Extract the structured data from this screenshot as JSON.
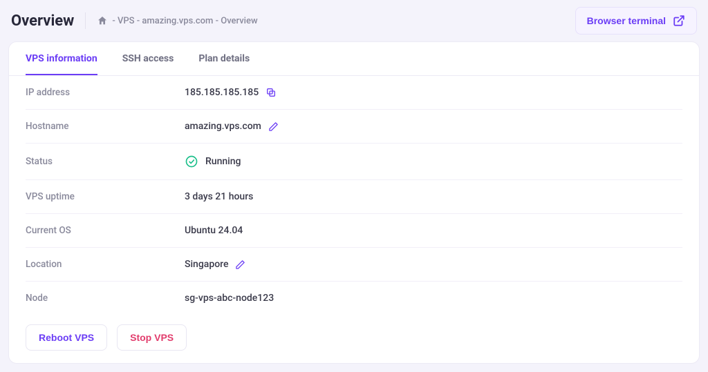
{
  "header": {
    "title": "Overview",
    "breadcrumb_text": "- VPS - amazing.vps.com - Overview",
    "terminal_button_label": "Browser terminal"
  },
  "tabs": {
    "info": "VPS information",
    "ssh": "SSH access",
    "plan": "Plan details"
  },
  "info": {
    "ip_label": "IP address",
    "ip_value": "185.185.185.185",
    "hostname_label": "Hostname",
    "hostname_value": "amazing.vps.com",
    "status_label": "Status",
    "status_value": "Running",
    "uptime_label": "VPS uptime",
    "uptime_value": "3 days 21 hours",
    "os_label": "Current OS",
    "os_value": "Ubuntu 24.04",
    "location_label": "Location",
    "location_value": "Singapore",
    "node_label": "Node",
    "node_value": "sg-vps-abc-node123"
  },
  "actions": {
    "reboot": "Reboot VPS",
    "stop": "Stop VPS"
  },
  "colors": {
    "accent": "#6b3df5",
    "danger": "#e23d6d",
    "success": "#1bbf8a",
    "muted": "#8a8a9c"
  }
}
